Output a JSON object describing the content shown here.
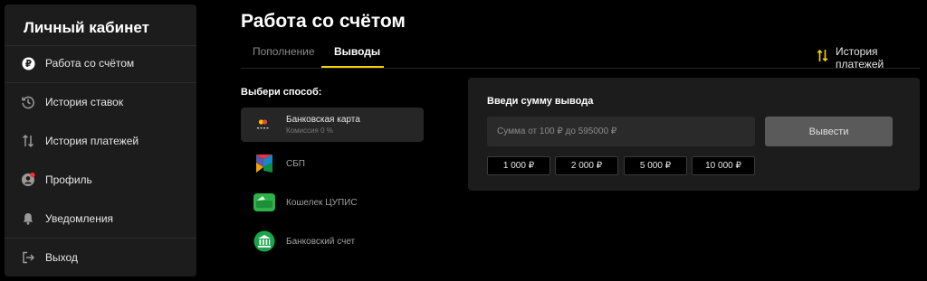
{
  "sidebar": {
    "title": "Личный кабинет",
    "items": [
      {
        "label": "Работа со счётом",
        "icon": "ruble-coin-icon"
      },
      {
        "label": "История ставок",
        "icon": "history-icon"
      },
      {
        "label": "История платежей",
        "icon": "swap-arrows-icon"
      },
      {
        "label": "Профиль",
        "icon": "profile-icon"
      },
      {
        "label": "Уведомления",
        "icon": "bell-icon"
      },
      {
        "label": "Выход",
        "icon": "logout-icon"
      }
    ]
  },
  "page": {
    "title": "Работа со счётом"
  },
  "tabs": [
    {
      "label": "Пополнение",
      "active": false
    },
    {
      "label": "Выводы",
      "active": true
    }
  ],
  "history_link": {
    "label": "История платежей",
    "icon": "swap-arrows-icon"
  },
  "methods": {
    "title": "Выбери способ:",
    "items": [
      {
        "name": "Банковская карта",
        "sub": "Комиссия 0 %",
        "icon": "bank-card-icon",
        "active": true
      },
      {
        "name": "СБП",
        "sub": "",
        "icon": "sbp-icon",
        "active": false
      },
      {
        "name": "Кошелек ЦУПИС",
        "sub": "",
        "icon": "wallet-icon",
        "active": false
      },
      {
        "name": "Банковский счет",
        "sub": "",
        "icon": "bank-building-icon",
        "active": false
      }
    ]
  },
  "withdraw": {
    "title": "Введи сумму вывода",
    "placeholder": "Сумма от 100 ₽ до 595000 ₽",
    "value": "",
    "submit_label": "Вывести",
    "quick_amounts": [
      "1 000 ₽",
      "2 000 ₽",
      "5 000 ₽",
      "10 000 ₽"
    ]
  },
  "colors": {
    "accent": "#f5d300",
    "background": "#000000",
    "panel": "#1c1c1c"
  }
}
